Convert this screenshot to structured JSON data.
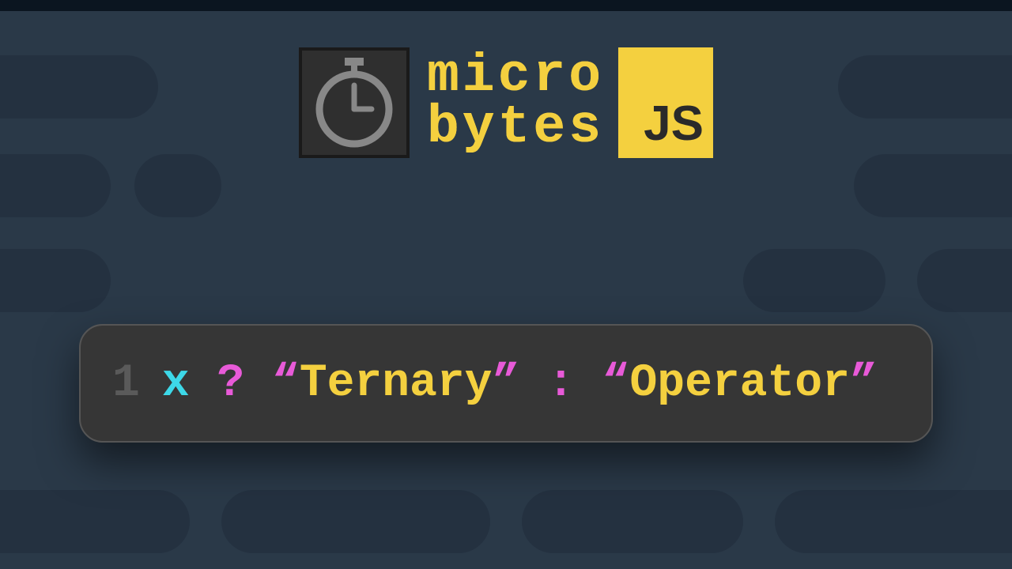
{
  "brand": {
    "line1": "micro",
    "line2": "bytes",
    "badge": "JS"
  },
  "code": {
    "lineNumber": "1",
    "variable": "x",
    "questionMark": "?",
    "quoteOpen1": "“",
    "string1": "Ternary",
    "quoteClose1": "”",
    "colon": ":",
    "quoteOpen2": "“",
    "string2": "Operator",
    "quoteClose2": "”"
  }
}
